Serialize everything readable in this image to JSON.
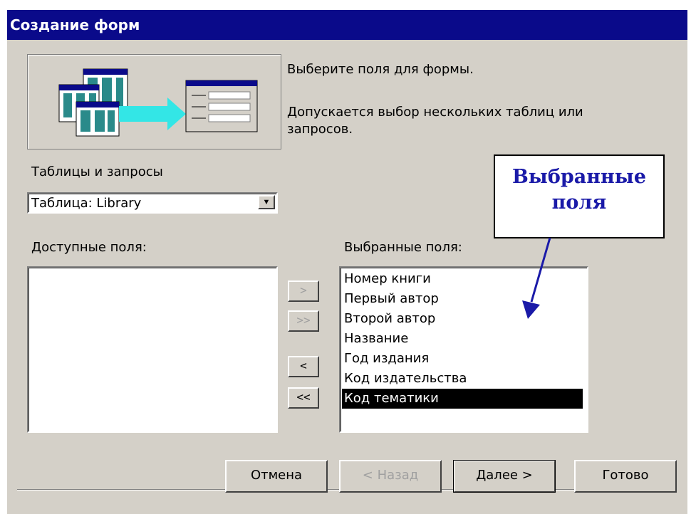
{
  "window": {
    "title": "Создание форм"
  },
  "intro": {
    "line1": "Выберите поля для формы.",
    "line2a": "Допускается выбор нескольких таблиц или",
    "line2b": "запросов."
  },
  "tables_queries": {
    "label": "Таблицы и запросы",
    "selected": "Таблица: Library"
  },
  "available": {
    "label": "Доступные поля:",
    "items": []
  },
  "selected_fields": {
    "label": "Выбранные поля:",
    "items": [
      "Номер книги",
      "Первый автор",
      "Второй автор",
      "Название",
      "Год издания",
      "Код издательства",
      "Код тематики"
    ],
    "highlighted": "Код тематики"
  },
  "move_buttons": {
    "add_one": ">",
    "add_all": ">>",
    "remove_one": "<",
    "remove_all": "<<"
  },
  "buttons": {
    "cancel": "Отмена",
    "back": "< Назад",
    "next": "Далее >",
    "finish": "Готово"
  },
  "callout": {
    "line1": "Выбранные",
    "line2": "поля"
  },
  "colors": {
    "titlebar": "#0a0a8a",
    "dialog": "#d4d0c8",
    "callout_text": "#1a1aa8"
  }
}
